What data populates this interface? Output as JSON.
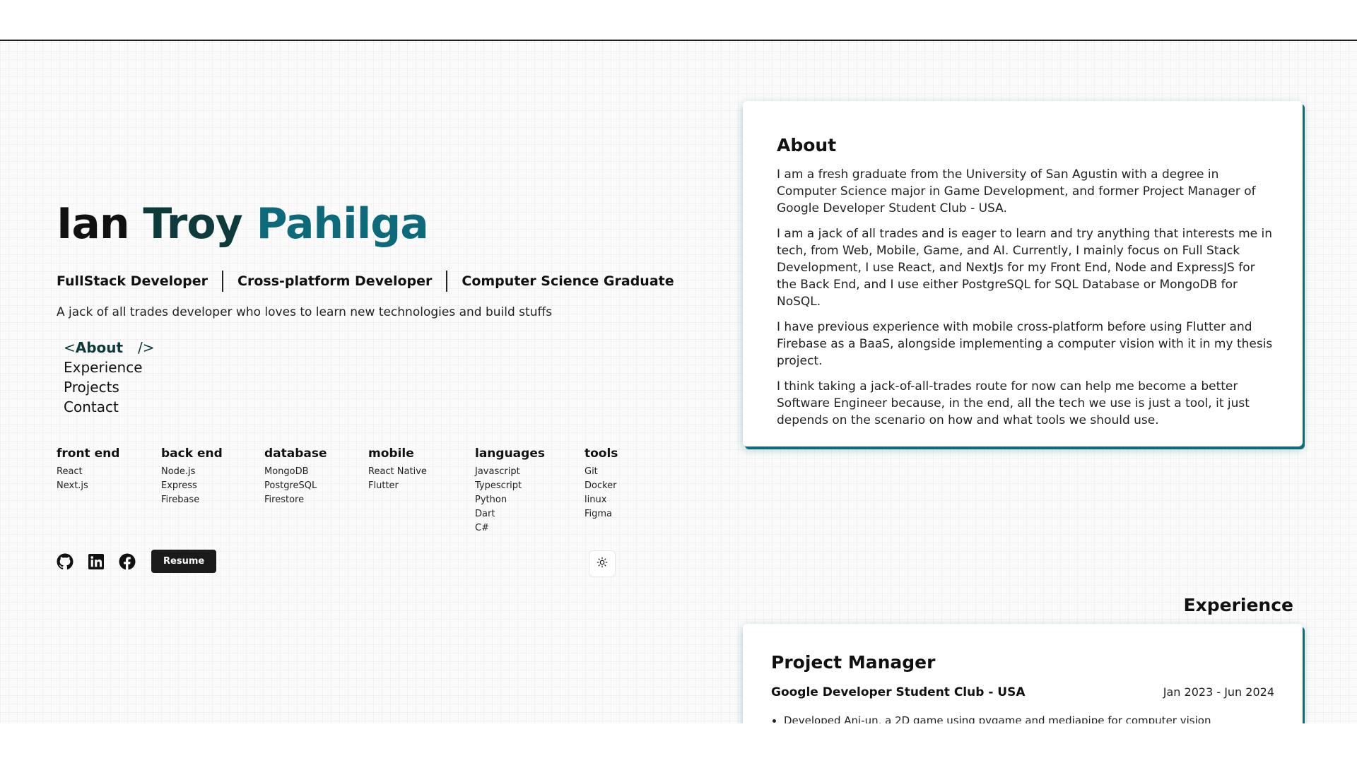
{
  "hero": {
    "first_name": "Ian",
    "middle_name": "Troy",
    "last_name": "Pahilga",
    "roles": [
      "FullStack Developer",
      "Cross-platform Developer",
      "Computer Science Graduate"
    ],
    "tagline": "A jack of all trades developer who loves to learn new technologies and build stuffs"
  },
  "nav": {
    "items": [
      "About",
      "Experience",
      "Projects",
      "Contact"
    ],
    "active": "About",
    "bracket_open": "<",
    "bracket_close": "/>"
  },
  "skills": [
    {
      "title": "front end",
      "items": [
        "React",
        "Next.js"
      ]
    },
    {
      "title": "back end",
      "items": [
        "Node.js",
        "Express",
        "Firebase"
      ]
    },
    {
      "title": "database",
      "items": [
        "MongoDB",
        "PostgreSQL",
        "Firestore"
      ]
    },
    {
      "title": "mobile",
      "items": [
        "React Native",
        "Flutter"
      ]
    },
    {
      "title": "languages",
      "items": [
        "Javascript",
        "Typescript",
        "Python",
        "Dart",
        "C#"
      ]
    },
    {
      "title": "tools",
      "items": [
        "Git",
        "Docker",
        "linux",
        "Figma"
      ]
    }
  ],
  "social": {
    "icons": [
      "github-icon",
      "linkedin-icon",
      "facebook-icon"
    ],
    "resume_label": "Resume",
    "theme_icon": "sun-icon"
  },
  "about": {
    "title": "About",
    "paragraphs": [
      "I am a fresh graduate from the University of San Agustin with a degree in Computer Science major in Game Development, and former Project Manager of Google Developer Student Club - USA.",
      "I am a jack of all trades and is eager to learn and try anything that interests me in tech, from Web, Mobile, Game, and AI. Currently, I mainly focus on Full Stack Development, I use React, and NextJs for my Front End, Node and ExpressJS for the Back End, and I use either PostgreSQL for SQL Database or MongoDB for NoSQL.",
      "I have previous experience with mobile cross-platform before using Flutter and Firebase as a BaaS, alongside implementing a computer vision with it in my thesis project.",
      "I think taking a jack-of-all-trades route for now can help me become a better Software Engineer because, in the end, all the tech we use is just a tool, it just depends on the scenario on how and what tools we should use."
    ]
  },
  "experience": {
    "heading": "Experience",
    "items": [
      {
        "role": "Project Manager",
        "org": "Google Developer Student Club - USA",
        "dates": "Jan 2023 - Jun 2024",
        "bullets": [
          "Developed Ani-un, a 2D game using pygame and mediapipe for computer vision"
        ]
      }
    ]
  },
  "colors": {
    "accent": "#0c6a7a",
    "accent_dark": "#0d3b3c",
    "button_dark": "#1b1b1b"
  }
}
